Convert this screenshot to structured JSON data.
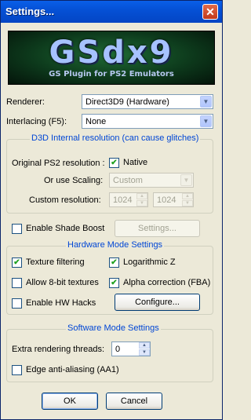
{
  "window": {
    "title": "Settings...",
    "close_glyph": "✕"
  },
  "logo": {
    "title": "GSdx9",
    "subtitle": "GS Plugin for PS2 Emulators"
  },
  "renderer": {
    "label": "Renderer:",
    "value": "Direct3D9 (Hardware)"
  },
  "interlacing": {
    "label": "Interlacing (F5):",
    "value": "None"
  },
  "d3d_group": {
    "legend": "D3D Internal resolution (can cause glitches)",
    "original_label": "Original PS2 resolution :",
    "native_label": "Native",
    "native_checked": true,
    "scaling_label": "Or use Scaling:",
    "scaling_value": "Custom",
    "custom_label": "Custom resolution:",
    "custom_width": "1024",
    "custom_height": "1024"
  },
  "shade_boost": {
    "label": "Enable Shade Boost",
    "checked": false,
    "settings_button": "Settings..."
  },
  "hw_group": {
    "legend": "Hardware Mode Settings",
    "texture_filtering": {
      "label": "Texture filtering",
      "checked": true
    },
    "logarithmic_z": {
      "label": "Logarithmic Z",
      "checked": true
    },
    "allow_8bit": {
      "label": "Allow 8-bit textures",
      "checked": false
    },
    "alpha_correction": {
      "label": "Alpha correction (FBA)",
      "checked": true
    },
    "hw_hacks": {
      "label": "Enable HW Hacks",
      "checked": false
    },
    "configure_button": "Configure..."
  },
  "sw_group": {
    "legend": "Software Mode Settings",
    "threads_label": "Extra rendering threads:",
    "threads_value": "0",
    "aa1": {
      "label": "Edge anti-aliasing (AA1)",
      "checked": false
    }
  },
  "buttons": {
    "ok": "OK",
    "cancel": "Cancel"
  },
  "colors": {
    "titlebar": "#0551d6",
    "dialog_bg": "#ece9d8",
    "group_legend": "#0046d5",
    "check_mark": "#21a121"
  },
  "icons": {
    "check": "✔",
    "dropdown": "▼",
    "spin_up": "▲",
    "spin_down": "▼"
  }
}
